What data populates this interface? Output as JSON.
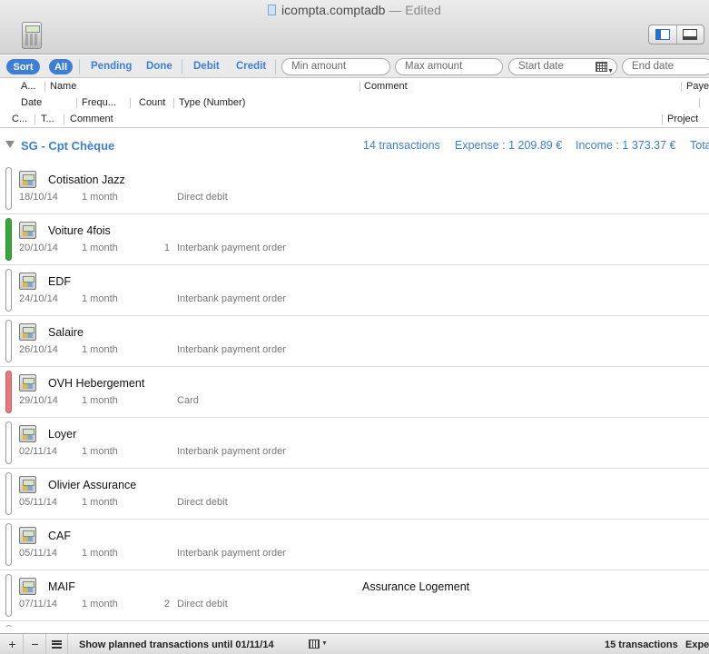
{
  "window": {
    "title": "icompta.comptadb",
    "edited": "— Edited"
  },
  "filters": {
    "sort": "Sort",
    "all": "All",
    "pending": "Pending",
    "done": "Done",
    "debit": "Debit",
    "credit": "Credit",
    "min_amount_placeholder": "Min amount",
    "max_amount_placeholder": "Max amount",
    "start_date_placeholder": "Start date",
    "end_date_placeholder": "End date"
  },
  "columns": {
    "a": "A...",
    "name": "Name",
    "comment_top": "Comment",
    "payee": "Payee",
    "date": "Date",
    "frequency": "Frequ...",
    "count": "Count",
    "type": "Type (Number)",
    "c": "C...",
    "t": "T...",
    "comment": "Comment",
    "project": "Project"
  },
  "group": {
    "name": "SG - Cpt Chèque",
    "transactions": "14 transactions",
    "expense": "Expense : 1 209.89 €",
    "income": "Income : 1 373.37 €",
    "total": "Total"
  },
  "rows": [
    {
      "name": "Cotisation Jazz",
      "date": "18/10/14",
      "frequency": "1 month",
      "count": "",
      "type": "Direct debit",
      "comment": "",
      "status": "none"
    },
    {
      "name": "Voiture 4fois",
      "date": "20/10/14",
      "frequency": "1 month",
      "count": "1",
      "type": "Interbank payment order",
      "comment": "",
      "status": "green"
    },
    {
      "name": "EDF",
      "date": "24/10/14",
      "frequency": "1 month",
      "count": "",
      "type": "Interbank payment order",
      "comment": "",
      "status": "none"
    },
    {
      "name": "Salaire",
      "date": "26/10/14",
      "frequency": "1 month",
      "count": "",
      "type": "Interbank payment order",
      "comment": "",
      "status": "none"
    },
    {
      "name": "OVH Hebergement",
      "date": "29/10/14",
      "frequency": "1 month",
      "count": "",
      "type": "Card",
      "comment": "",
      "status": "red"
    },
    {
      "name": "Loyer",
      "date": "02/11/14",
      "frequency": "1 month",
      "count": "",
      "type": "Interbank payment order",
      "comment": "",
      "status": "none"
    },
    {
      "name": "Olivier Assurance",
      "date": "05/11/14",
      "frequency": "1 month",
      "count": "",
      "type": "Direct debit",
      "comment": "",
      "status": "none"
    },
    {
      "name": "CAF",
      "date": "05/11/14",
      "frequency": "1 month",
      "count": "",
      "type": "Interbank payment order",
      "comment": "",
      "status": "none"
    },
    {
      "name": "MAIF",
      "date": "07/11/14",
      "frequency": "1 month",
      "count": "2",
      "type": "Direct debit",
      "comment": "Assurance Logement",
      "status": "none"
    },
    {
      "name": "",
      "date": "",
      "frequency": "",
      "count": "",
      "type": "",
      "comment": "",
      "status": "none"
    }
  ],
  "footer": {
    "add": "+",
    "remove": "−",
    "planned_label": "Show planned transactions until 01/11/14",
    "transaction_count": "15 transactions",
    "expense_cut": "Expe"
  },
  "colors": {
    "accent": "#3d7fd6",
    "status_green": "#35a83a",
    "status_red": "#e37a7d"
  }
}
